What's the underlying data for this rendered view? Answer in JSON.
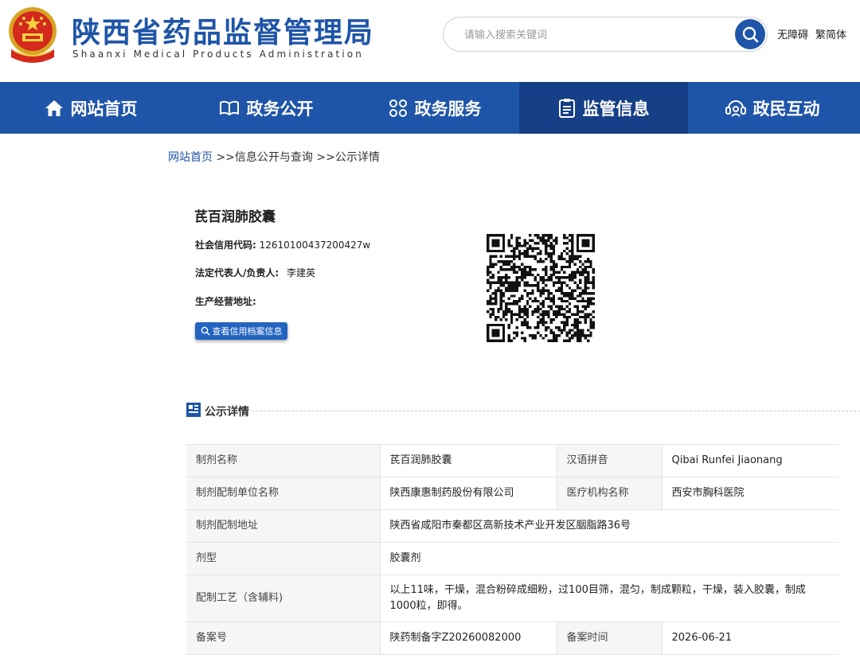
{
  "header": {
    "title": "陕西省药品监督管理局",
    "subtitle": "Shaanxi Medical Products Administration",
    "search_placeholder": "请输入搜索关键词",
    "links": [
      "无障碍",
      "繁简体"
    ]
  },
  "nav": {
    "items": [
      {
        "label": "网站首页",
        "icon": "home-icon"
      },
      {
        "label": "政务公开",
        "icon": "book-icon"
      },
      {
        "label": "政务服务",
        "icon": "grid-icon"
      },
      {
        "label": "监管信息",
        "icon": "clipboard-icon",
        "active": true
      },
      {
        "label": "政民互动",
        "icon": "interaction-icon"
      }
    ],
    "colors": {
      "bar": "#1f55a8",
      "active": "#153f86"
    }
  },
  "breadcrumb": {
    "home": "网站首页",
    "rest": " >>信息公开与查询 >>公示详情"
  },
  "info": {
    "name": "芪百润肺胶囊",
    "credit_code_label": "社会信用代码:",
    "credit_code": "12610100437200427w",
    "legal_rep_label": "法定代表人/负责人:",
    "legal_rep": "李建英",
    "address_label": "生产经营地址:",
    "address": "",
    "credit_button": "查看信用档案信息"
  },
  "section": {
    "title": "公示详情"
  },
  "detail": {
    "rows": [
      {
        "k1": "制剂名称",
        "v1": "芪百润肺胶囊",
        "k2": "汉语拼音",
        "v2": "Qibai Runfei Jiaonang"
      },
      {
        "k1": "制剂配制单位名称",
        "v1": "陕西康惠制药股份有限公司",
        "k2": "医疗机构名称",
        "v2": "西安市胸科医院"
      },
      {
        "k1": "制剂配制地址",
        "v1": "陕西省咸阳市秦都区高新技术产业开发区胭脂路36号"
      },
      {
        "k1": "剂型",
        "v1": "胶囊剂"
      },
      {
        "k1": "配制工艺（含辅料)",
        "v1": "以上11味，干燥，混合粉碎成细粉，过100目筛，混匀，制成颗粒，干燥，装入胶囊，制成1000粒，即得。"
      },
      {
        "k1": "备案号",
        "v1": "陕药制备字Z20260082000",
        "k2": "备案时间",
        "v2": "2026-06-21"
      }
    ]
  }
}
